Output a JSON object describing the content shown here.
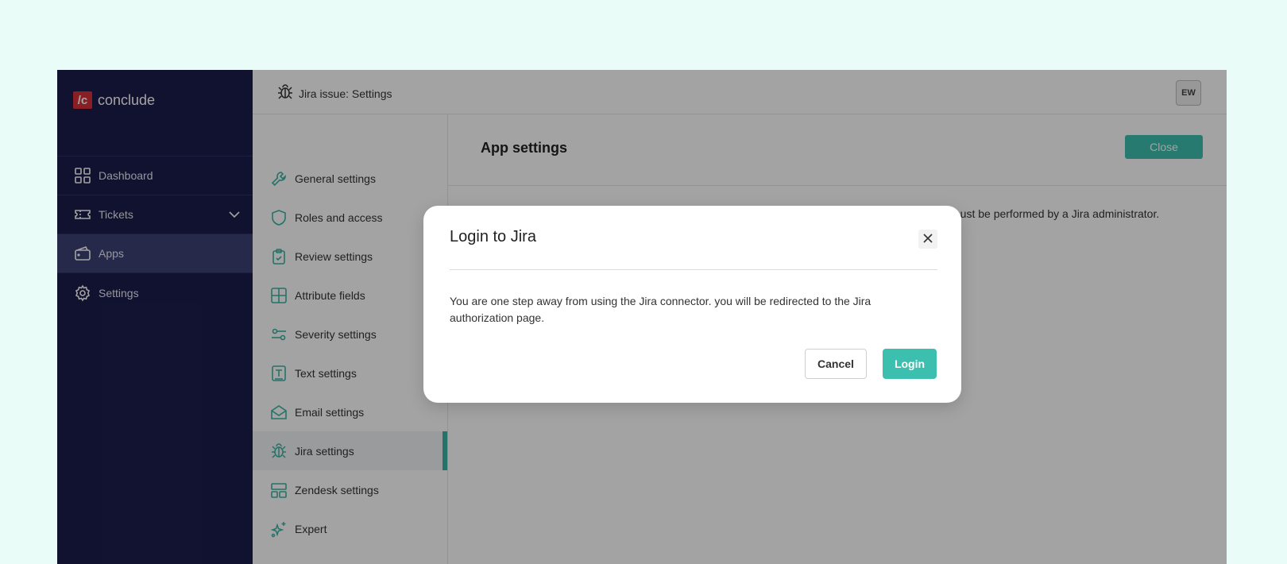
{
  "brand": {
    "mark": "/c",
    "name": "conclude"
  },
  "sidebar": {
    "items": [
      {
        "label": "Dashboard",
        "icon": "grid-icon"
      },
      {
        "label": "Tickets",
        "icon": "ticket-icon"
      },
      {
        "label": "Apps",
        "icon": "wallet-icon",
        "active": true
      },
      {
        "label": "Settings",
        "icon": "gear-icon"
      }
    ]
  },
  "header": {
    "title": "Jira issue: Settings",
    "avatar": "EW"
  },
  "settings_menu": {
    "items": [
      {
        "label": "General settings",
        "icon": "wrench-icon"
      },
      {
        "label": "Roles and access",
        "icon": "shield-icon"
      },
      {
        "label": "Review settings",
        "icon": "clipboard-check-icon"
      },
      {
        "label": "Attribute fields",
        "icon": "table-icon"
      },
      {
        "label": "Severity settings",
        "icon": "sliders-icon"
      },
      {
        "label": "Text settings",
        "icon": "text-box-icon"
      },
      {
        "label": "Email settings",
        "icon": "envelope-open-icon"
      },
      {
        "label": "Jira settings",
        "icon": "bug-icon",
        "active": true
      },
      {
        "label": "Zendesk settings",
        "icon": "layout-icon"
      },
      {
        "label": "Expert",
        "icon": "sparkles-icon"
      }
    ]
  },
  "content": {
    "title": "App settings",
    "close_label": "Close",
    "partial_text": "must be performed by a Jira administrator."
  },
  "modal": {
    "title": "Login to Jira",
    "body": "You are one step away from using the Jira connector. you will be redirected to the Jira authorization page.",
    "cancel_label": "Cancel",
    "login_label": "Login"
  },
  "colors": {
    "page_bg": "#eafcf8",
    "sidebar_bg": "#1c1d4b",
    "accent": "#3cbfae",
    "brand_red": "#d8303a"
  }
}
